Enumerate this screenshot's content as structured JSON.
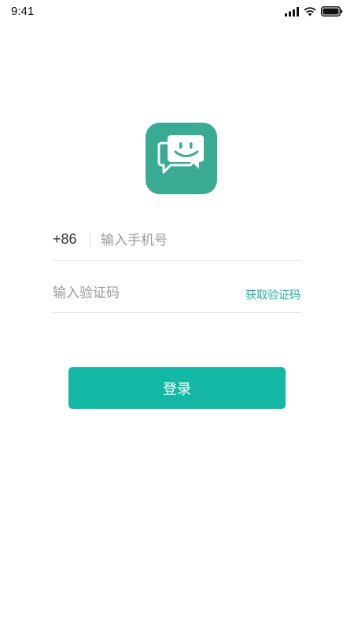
{
  "status_bar": {
    "time": "9:41",
    "icons": [
      "cellular-signal-icon",
      "wifi-icon",
      "battery-icon"
    ]
  },
  "logo": {
    "icon": "chat-smile-icon",
    "color": "#3aab93"
  },
  "form": {
    "country_code": "+86",
    "phone_placeholder": "输入手机号",
    "code_placeholder": "输入验证码",
    "get_code_label": "获取验证码"
  },
  "login_button": {
    "label": "登录",
    "color": "#13b8a4"
  }
}
